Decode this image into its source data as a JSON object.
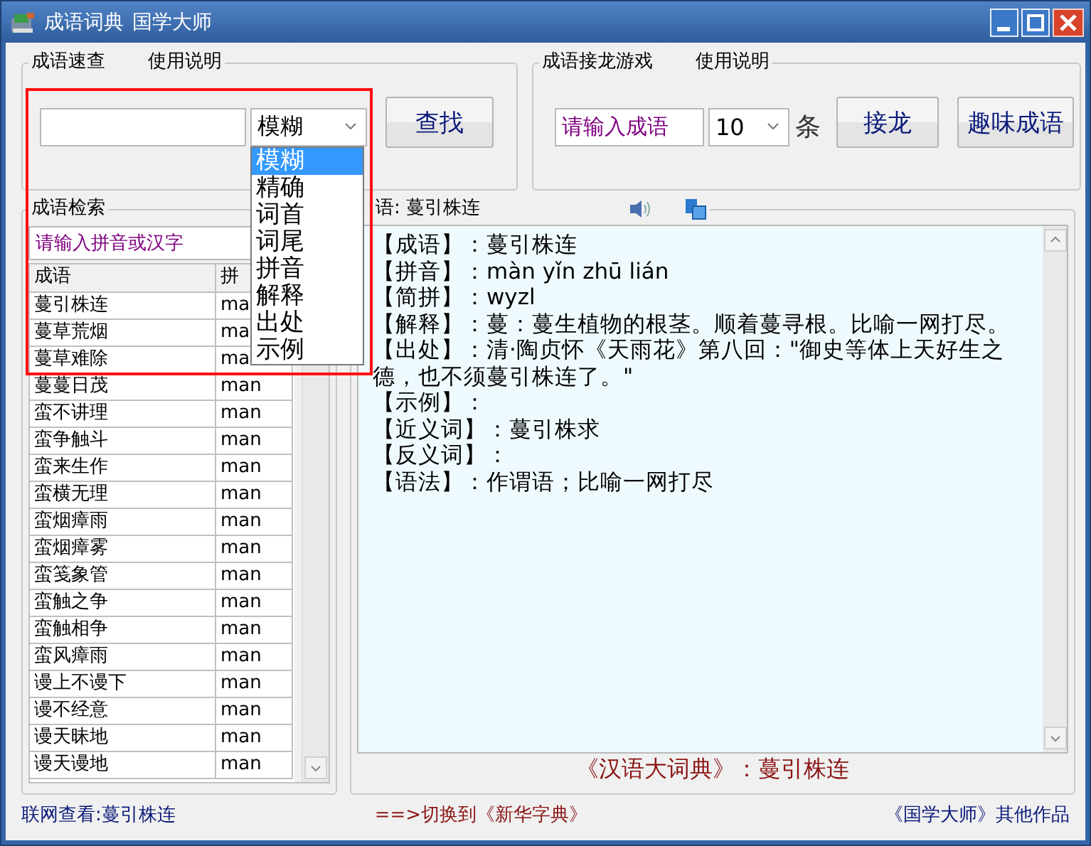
{
  "window": {
    "title": "成语词典",
    "subtitle": "国学大师"
  },
  "quick_search": {
    "title": "成语速查",
    "help": "使用说明",
    "mode": {
      "value": "模糊",
      "open": true,
      "options": [
        {
          "label": "模糊",
          "selected": true
        },
        {
          "label": "精确",
          "selected": false
        },
        {
          "label": "词首",
          "selected": false
        },
        {
          "label": "词尾",
          "selected": false
        },
        {
          "label": "拼音",
          "selected": false
        },
        {
          "label": "解释",
          "selected": false
        },
        {
          "label": "出处",
          "selected": false
        },
        {
          "label": "示例",
          "selected": false
        }
      ]
    },
    "button": "查找"
  },
  "solitaire": {
    "title": "成语接龙游戏",
    "help": "使用说明",
    "input": {
      "placeholder": "请输入成语"
    },
    "count": "10",
    "unit": "条",
    "buttons": [
      "接龙",
      "趣味成语"
    ]
  },
  "idiom_search": {
    "title": "成语检索",
    "search": {
      "placeholder": "请输入拼音或汉字"
    },
    "columns": [
      "成语",
      "拼"
    ],
    "rows": [
      [
        "蔓引株连",
        "ma"
      ],
      [
        "蔓草荒烟",
        "ma"
      ],
      [
        "蔓草难除",
        "ma"
      ],
      [
        "蔓蔓日茂",
        "man"
      ],
      [
        "蛮不讲理",
        "man"
      ],
      [
        "蛮争触斗",
        "man"
      ],
      [
        "蛮来生作",
        "man"
      ],
      [
        "蛮横无理",
        "man"
      ],
      [
        "蛮烟瘴雨",
        "man"
      ],
      [
        "蛮烟瘴雾",
        "man"
      ],
      [
        "蛮笺象管",
        "man"
      ],
      [
        "蛮触之争",
        "man"
      ],
      [
        "蛮触相争",
        "man"
      ],
      [
        "蛮风瘴雨",
        "man"
      ],
      [
        "谩上不谩下",
        "man"
      ],
      [
        "谩不经意",
        "man"
      ],
      [
        "谩天昧地",
        "man"
      ],
      [
        "谩天谩地",
        "man"
      ]
    ]
  },
  "detail": {
    "title": "语: 蔓引株连",
    "lines": [
      "【成语】：蔓引株连",
      "【拼音】：màn  yǐn  zhū  lián",
      "【简拼】：wyzl",
      "【解释】：蔓：蔓生植物的根茎。顺着蔓寻根。比喻一网打尽。",
      "【出处】：清·陶贞怀《天雨花》第八回：\"御史等体上天好生之德，也不须蔓引株连了。\"",
      "【示例】：",
      "【近义词】：蔓引株求",
      "【反义词】：",
      "【语法】：作谓语；比喻一网打尽"
    ],
    "source": "《汉语大词典》：蔓引株连"
  },
  "footer": {
    "online": "联网查看:蔓引株连",
    "switch": "==>切换到《新华字典》",
    "others": "《国学大师》其他作品"
  },
  "highlight_frame": true
}
